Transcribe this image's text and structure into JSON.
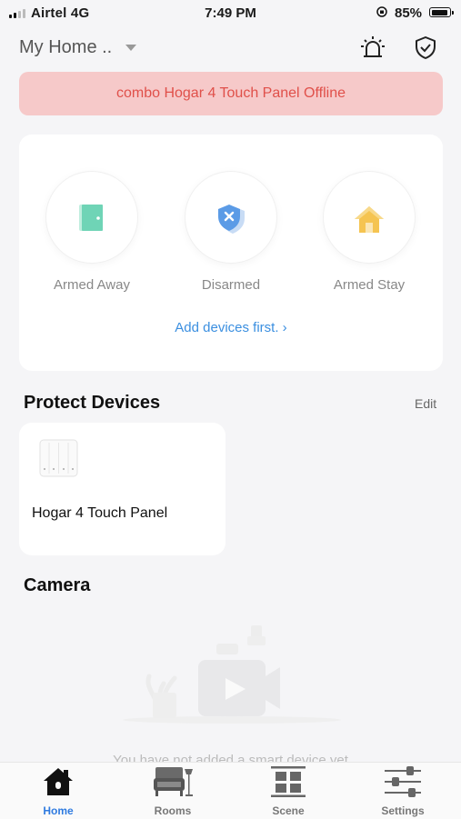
{
  "status_bar": {
    "carrier": "Airtel  4G",
    "time": "7:49 PM",
    "battery_percent": "85%"
  },
  "header": {
    "home_name": "My Home ..",
    "icons": [
      "alarm-light-icon",
      "shield-check-icon"
    ]
  },
  "banner": {
    "text": "combo Hogar 4 Touch Panel Offline",
    "background": "#f6c9c9",
    "color": "#e0504a"
  },
  "security": {
    "modes": [
      {
        "label": "Armed Away",
        "icon": "door-icon",
        "color": "#6fd4b6"
      },
      {
        "label": "Disarmed",
        "icon": "shield-x-icon",
        "color": "#5b9be6"
      },
      {
        "label": "Armed Stay",
        "icon": "house-icon",
        "color": "#f5c451"
      }
    ],
    "add_link": "Add devices first. ›"
  },
  "protect_devices": {
    "title": "Protect Devices",
    "edit_label": "Edit",
    "devices": [
      {
        "name": "Hogar 4 Touch Panel",
        "icon": "touch-panel-icon"
      }
    ]
  },
  "camera": {
    "title": "Camera",
    "empty_text": "You have not added a smart device yet"
  },
  "tabbar": {
    "tabs": [
      {
        "label": "Home",
        "icon": "home-icon",
        "active": true
      },
      {
        "label": "Rooms",
        "icon": "sofa-icon",
        "active": false
      },
      {
        "label": "Scene",
        "icon": "scene-grid-icon",
        "active": false
      },
      {
        "label": "Settings",
        "icon": "sliders-icon",
        "active": false
      }
    ],
    "active_color": "#2f7be0"
  }
}
